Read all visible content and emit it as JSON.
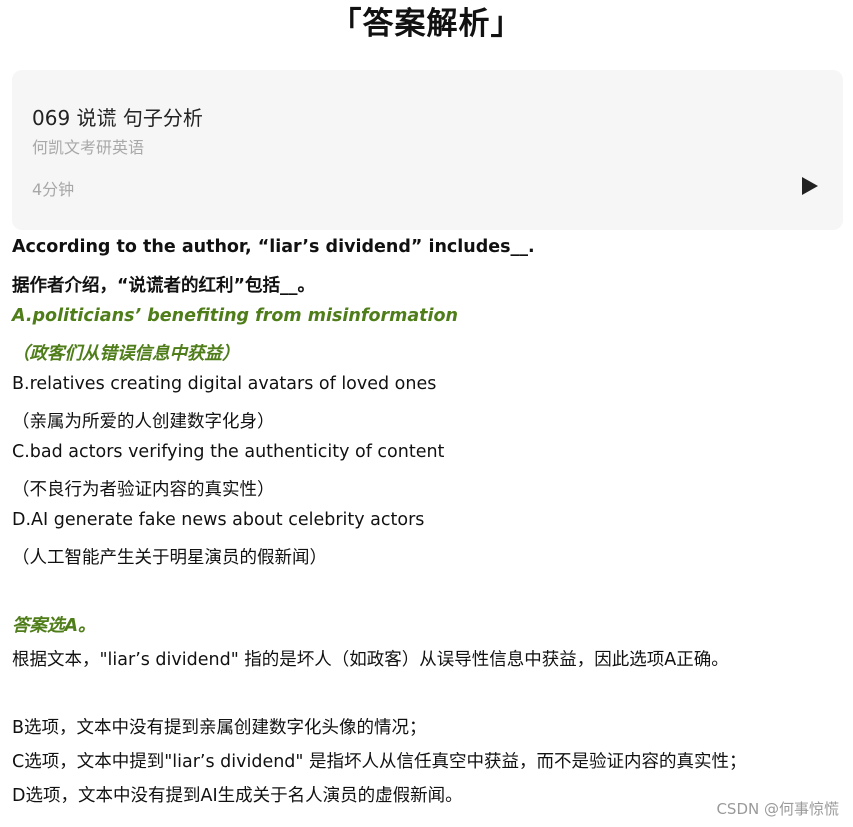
{
  "page": {
    "title": "「答案解析」"
  },
  "audio_card": {
    "title": "069 说谎 句子分析",
    "author": "何凯文考研英语",
    "duration": "4分钟",
    "play_icon": "play-icon"
  },
  "question": {
    "en": "According to the author, “liar’s dividend” includes__.",
    "zh": "据作者介绍，“说谎者的红利”包括__。"
  },
  "options": [
    {
      "en": "A.politicians’ benefiting from misinformation",
      "zh": "（政客们从错误信息中获益）",
      "correct": true
    },
    {
      "en": "B.relatives creating digital avatars of loved ones",
      "zh": "（亲属为所爱的人创建数字化身）",
      "correct": false
    },
    {
      "en": "C.bad actors verifying the authenticity of content",
      "zh": "（不良行为者验证内容的真实性）",
      "correct": false
    },
    {
      "en": "D.AI generate fake news about celebrity actors",
      "zh": "（人工智能产生关于明星演员的假新闻）",
      "correct": false
    }
  ],
  "answer": {
    "label": "答案选A。",
    "explanation": "根据文本，\"liar’s dividend\" 指的是坏人（如政客）从误导性信息中获益，因此选项A正确。",
    "notes": [
      "B选项，文本中没有提到亲属创建数字化头像的情况；",
      "C选项，文本中提到\"liar’s dividend\" 是指坏人从信任真空中获益，而不是验证内容的真实性；",
      "D选项，文本中没有提到AI生成关于名人演员的虚假新闻。"
    ]
  },
  "footer": {
    "watermark": "CSDN @何事惊慌"
  },
  "colors": {
    "correct_green": "#4f7d1a",
    "card_bg": "#f6f6f6",
    "muted_gray": "#a8a8a8"
  }
}
